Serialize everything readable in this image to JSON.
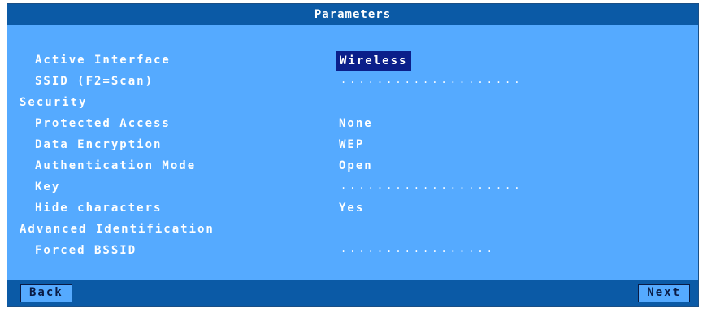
{
  "window": {
    "title": "Parameters"
  },
  "fields": {
    "active_interface": {
      "label": "Active Interface",
      "value": "Wireless"
    },
    "ssid": {
      "label": "SSID (F2=Scan)",
      "value": "...................."
    },
    "security_header": "Security",
    "protected_access": {
      "label": "Protected Access",
      "value": "None"
    },
    "data_encryption": {
      "label": "Data Encryption",
      "value": "WEP"
    },
    "authentication_mode": {
      "label": "Authentication Mode",
      "value": "Open"
    },
    "key": {
      "label": "Key",
      "value": "...................."
    },
    "hide_characters": {
      "label": "Hide characters",
      "value": "Yes"
    },
    "advanced_header": "Advanced Identification",
    "forced_bssid": {
      "label": "Forced BSSID",
      "value": "................."
    }
  },
  "footer": {
    "back_label": "Back",
    "next_label": "Next"
  },
  "colors": {
    "background": "#55aaff",
    "titlebar": "#0b5aa6",
    "selection": "#0b1f8a",
    "text": "#ffffff"
  }
}
